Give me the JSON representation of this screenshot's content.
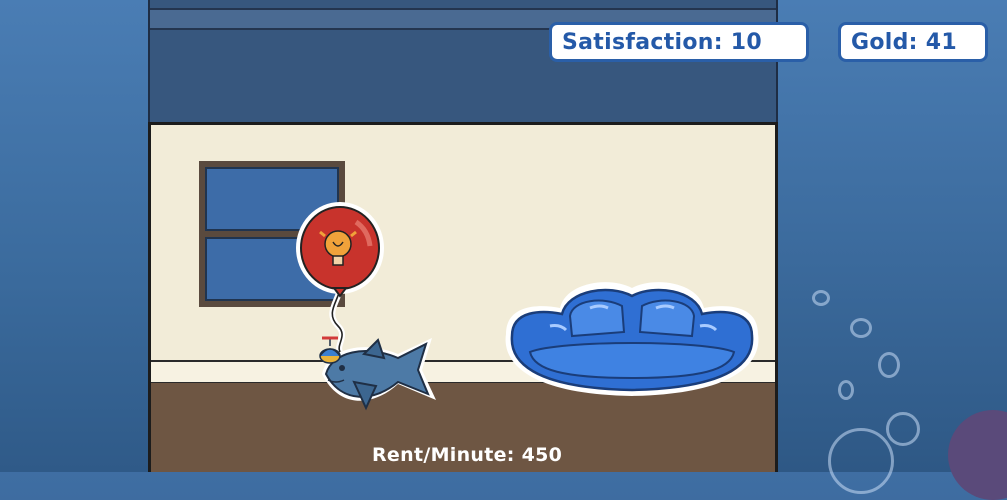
{
  "hud": {
    "satisfaction_label": "Satisfaction: 10",
    "gold_label": "Gold: 41"
  },
  "room": {
    "rent_label": "Rent/Minute: 450"
  },
  "scene": {
    "items": [
      "red-balloon-with-lightbulb",
      "blue-fish-with-propeller-hat",
      "blue-sofa",
      "window"
    ]
  },
  "colors": {
    "hud_text": "#2459a8",
    "hud_border": "#2a5fa8",
    "wall": "#f2ecd8",
    "floor": "#6e5643",
    "ocean": "#3f6ea3"
  }
}
